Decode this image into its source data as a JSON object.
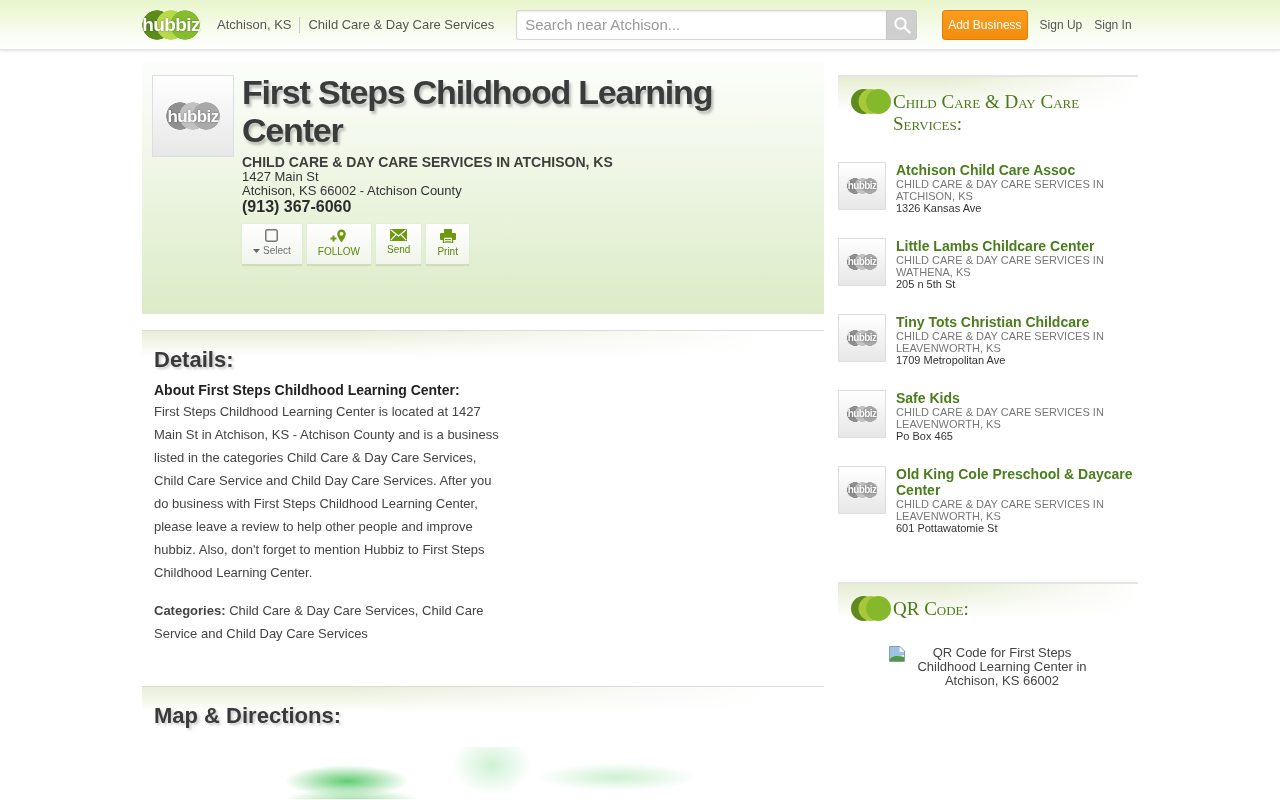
{
  "header": {
    "logo": "hubbiz",
    "breadcrumbs": [
      "Atchison, KS",
      "Child Care & Day Care Services"
    ],
    "search": {
      "placeholder": "Search near Atchison..."
    },
    "add_business": "Add Business",
    "links": [
      "Sign Up",
      "Sign In"
    ]
  },
  "business": {
    "thumbnail_logo": "hubbiz",
    "name": "First Steps Childhood Learning Center",
    "category_line": "CHILD CARE & DAY CARE SERVICES IN ATCHISON, KS",
    "address_lines": [
      "1427 Main St",
      "Atchison, KS 66002 - Atchison County"
    ],
    "phone": "(913) 367-6060",
    "actions": [
      {
        "kind": "select",
        "label": "Select",
        "checked": false
      },
      {
        "kind": "follow",
        "label": "FOLLOW"
      },
      {
        "kind": "send",
        "label": "Send"
      },
      {
        "kind": "print",
        "label": "Print"
      }
    ]
  },
  "details": {
    "heading": "Details:",
    "about_heading": "About First Steps Childhood Learning Center:",
    "about_text": "First Steps Childhood Learning Center is located at 1427 Main St in Atchison, KS - Atchison County and is a business listed in the categories Child Care & Day Care Services, Child Care Service and Child Day Care Services. After you do business with First Steps Childhood Learning Center, please leave a review to help other people and improve hubbiz. Also, don't forget to mention Hubbiz to First Steps Childhood Learning Center.",
    "categories": "**Categories:** Child Care & Day Care Services, Child Care Service and Child Day Care Services"
  },
  "map": {
    "heading": "Map & Directions:"
  },
  "sidebar": {
    "related": {
      "title": "Child Care & Day Care Services:",
      "items": [
        {
          "thumbnail_logo": "hubbiz",
          "name": "Atchison Child Care Assoc",
          "category": "CHILD CARE & DAY CARE SERVICES IN ATCHISON, KS",
          "address": "1326 Kansas Ave"
        },
        {
          "thumbnail_logo": "hubbiz",
          "name": "Little Lambs Childcare Center",
          "category": "CHILD CARE & DAY CARE SERVICES IN WATHENA, KS",
          "address": "205 n 5th St"
        },
        {
          "thumbnail_logo": "hubbiz",
          "name": "Tiny Tots Christian Childcare",
          "category": "CHILD CARE & DAY CARE SERVICES IN LEAVENWORTH, KS",
          "address": "1709 Metropolitan Ave"
        },
        {
          "thumbnail_logo": "hubbiz",
          "name": "Safe Kids",
          "category": "CHILD CARE & DAY CARE SERVICES IN LEAVENWORTH, KS",
          "address": "Po Box 465"
        },
        {
          "thumbnail_logo": "hubbiz",
          "name": "Old King Cole Preschool & Daycare Center",
          "category": "CHILD CARE & DAY CARE SERVICES IN LEAVENWORTH, KS",
          "address": "601 Pottawatomie St"
        }
      ]
    },
    "qr": {
      "title": "QR Code:",
      "image_alt": "QR Code for First Steps Childhood Learning Center in Atchison, KS 66002"
    }
  }
}
